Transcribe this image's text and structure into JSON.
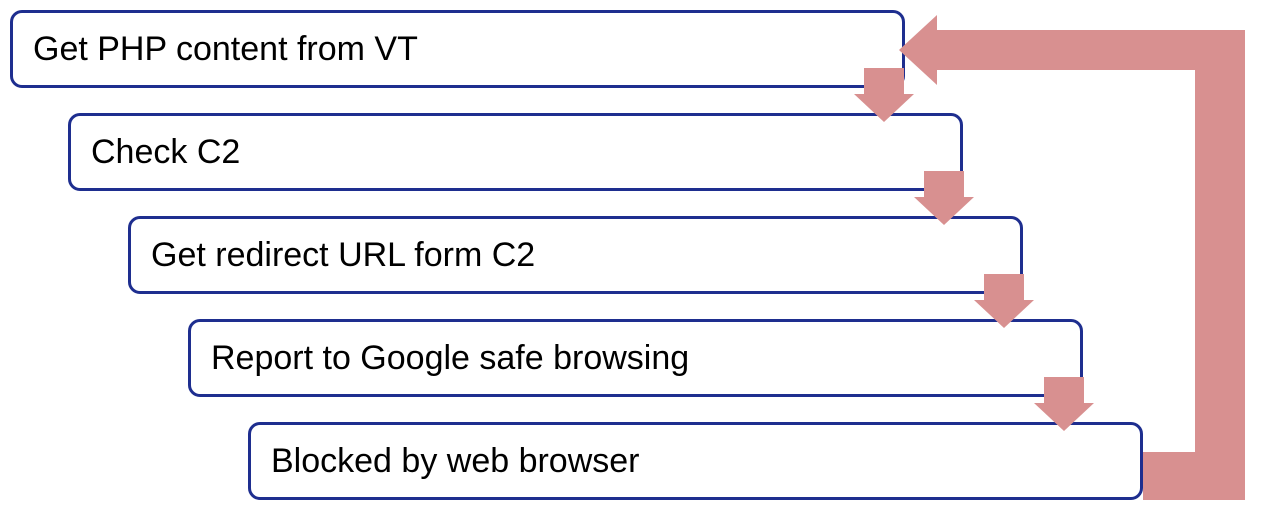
{
  "colors": {
    "arrow": "#d89090",
    "box_border": "#1e2e8f"
  },
  "steps": [
    {
      "label": "Get PHP content from VT"
    },
    {
      "label": "Check C2"
    },
    {
      "label": "Get redirect URL form C2"
    },
    {
      "label": "Report to Google safe browsing"
    },
    {
      "label": "Blocked by web browser"
    }
  ]
}
